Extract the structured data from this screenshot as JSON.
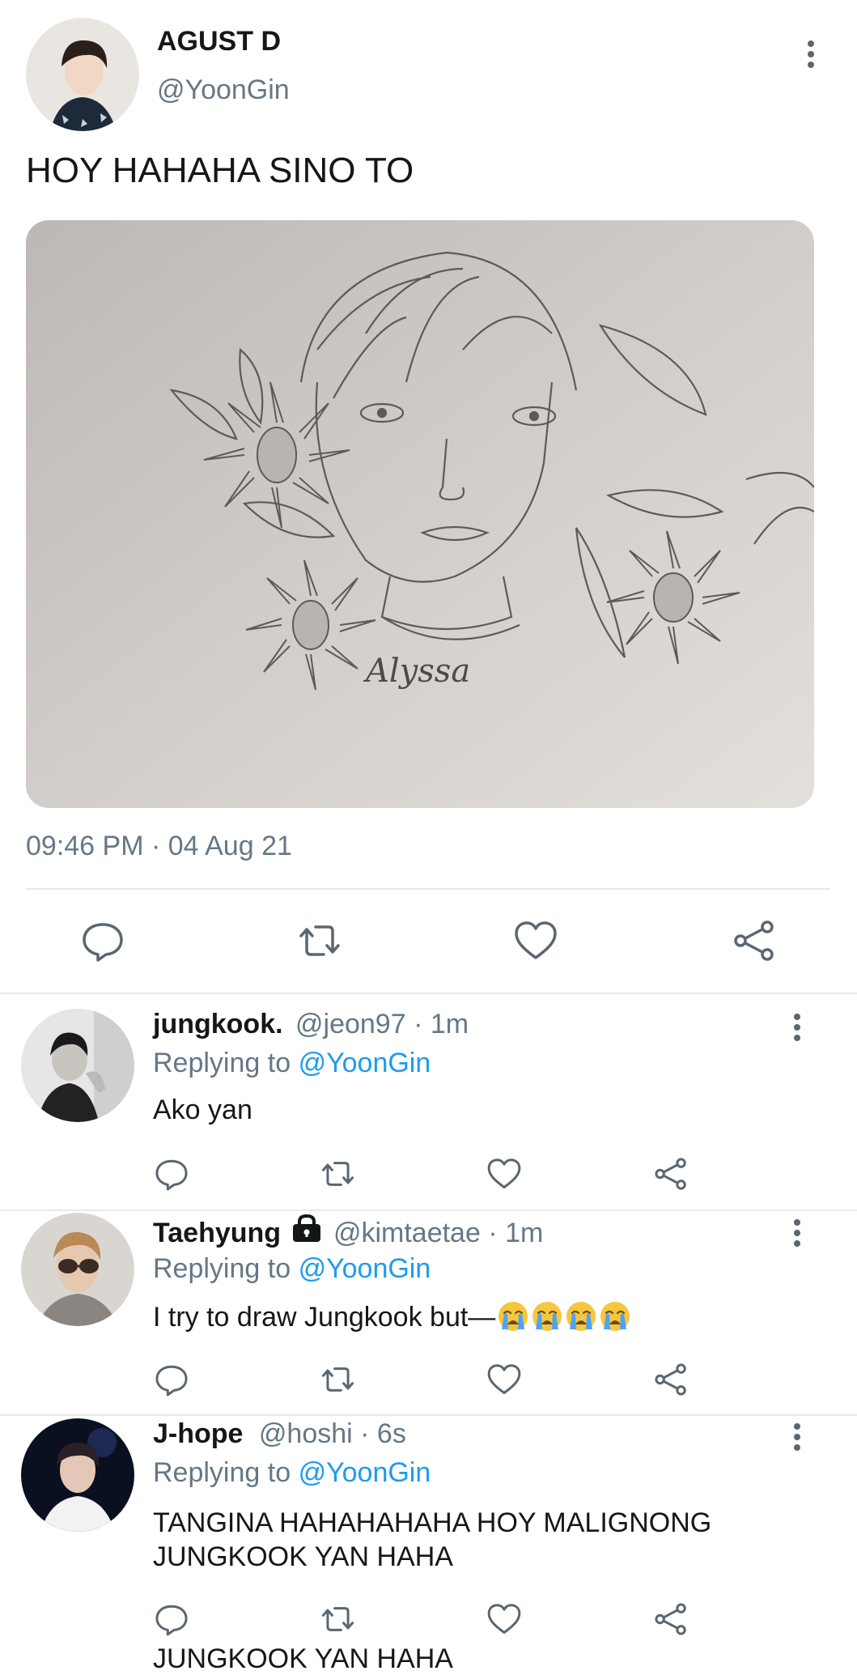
{
  "main_tweet": {
    "author_name": "AGUST D",
    "handle": "@YoonGin",
    "text": "HOY HAHAHA SINO TO",
    "image_signature": "Alyssa",
    "timestamp": "09:46 PM · 04 Aug 21"
  },
  "replies": [
    {
      "name": "jungkook.",
      "meta": "@jeon97 · 1m",
      "replying_prefix": "Replying to",
      "replying_to": "@YoonGin",
      "text": "Ako yan"
    },
    {
      "name": "Taehyung",
      "meta": "@kimtaetae · 1m",
      "replying_prefix": "Replying to",
      "replying_to": "@YoonGin",
      "text": "I try to draw Jungkook but—",
      "emoji_count": 4,
      "locked": true
    },
    {
      "name": "J-hope",
      "meta": "@hoshi · 6s",
      "replying_prefix": "Replying to",
      "replying_to": "@YoonGin",
      "text_line1": "TANGINA HAHAHAHAHA HOY MALIGNONG",
      "text_line2": "JUNGKOOK YAN HAHA",
      "cutoff_text": "JUNGKOOK YAN HAHA"
    }
  ],
  "icons": [
    "more-vert-icon",
    "reply-icon",
    "retweet-icon",
    "like-icon",
    "share-icon",
    "lock-icon",
    "crying-face-emoji"
  ],
  "colors": {
    "link": "#1d9bf0",
    "muted": "#657786",
    "icon": "#5b6670",
    "divider": "#e6e9ec"
  }
}
